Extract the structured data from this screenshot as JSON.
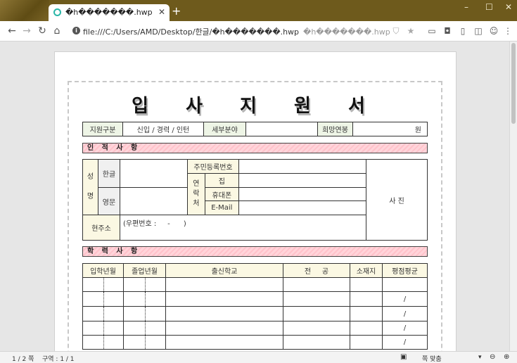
{
  "browser": {
    "tab_title": "�h�������.hwp",
    "tab_close": "✕",
    "new_tab": "+",
    "window_controls": [
      "–",
      "☐",
      "✕"
    ],
    "url": "file:///C:/Users/AMD/Desktop/한글/�h�������.hwp",
    "url_ghost": "�h�������.hwp",
    "nav": {
      "back": "←",
      "forward": "→",
      "reload": "↻",
      "home": "⌂"
    },
    "info_glyph": "i",
    "icons": [
      "shield-icon",
      "star-icon",
      "camera-icon",
      "screenshot-icon",
      "reader-icon",
      "sidebar-icon",
      "profile-icon",
      "menu-icon"
    ],
    "icon_glyphs": [
      "⛉",
      "★",
      "▭",
      "◘",
      "▯",
      "◫",
      "☺",
      "⋮"
    ]
  },
  "document": {
    "title": "입 사 지 원 서",
    "row1": {
      "apply_type_label": "지원구분",
      "apply_type_value": "신입 / 경력 / 인턴",
      "detail_field_label": "세부분야",
      "detail_field_value": "",
      "desired_salary_label": "희망연봉",
      "desired_salary_unit": "원"
    },
    "personal_section": "인 적 사 항",
    "personal": {
      "name_label": "성\n\n명",
      "korean_label": "한글",
      "english_label": "영문",
      "rrn_label": "주민등록번호",
      "contact_label": "연\n락\n처",
      "home_label": "집",
      "mobile_label": "휴대폰",
      "email_label": "E-Mail",
      "address_label": "현주소",
      "address_value": "(우편번호 :     -      )",
      "photo_label": "사   진"
    },
    "education_section": "학 력 사 항",
    "education": {
      "headers": [
        "입학년월",
        "졸업년월",
        "출신학교",
        "전     공",
        "소재지",
        "평점평균"
      ],
      "gpa_slash": [
        "",
        "/",
        "/",
        "/",
        "/"
      ]
    }
  },
  "statusbar": {
    "page": "1 / 2 쪽",
    "section": "구역 : 1 / 1",
    "fit_mode": "쪽 맞춤",
    "dropdown": "▾",
    "zoom_out": "⊖",
    "zoom_in": "⊕",
    "view_glyph": "▣"
  }
}
